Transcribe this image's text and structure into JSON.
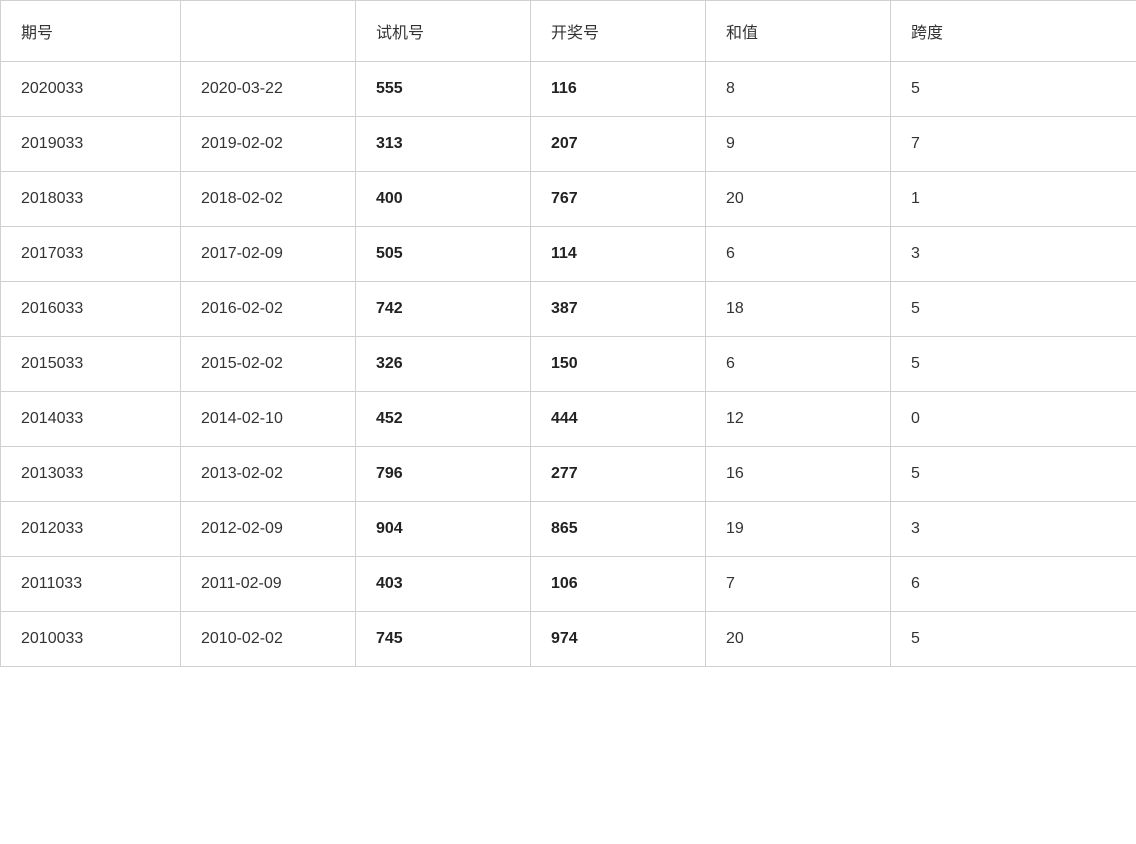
{
  "table": {
    "headers": [
      {
        "key": "qihao",
        "label": "期号"
      },
      {
        "key": "date",
        "label": ""
      },
      {
        "key": "shiji",
        "label": "试机号"
      },
      {
        "key": "kaijang",
        "label": "开奖号"
      },
      {
        "key": "hezhi",
        "label": "和值"
      },
      {
        "key": "kuadu",
        "label": "跨度"
      }
    ],
    "rows": [
      {
        "qihao": "2020033",
        "date": "2020-03-22",
        "shiji": "555",
        "kaijang": "116",
        "hezhi": "8",
        "kuadu": "5"
      },
      {
        "qihao": "2019033",
        "date": "2019-02-02",
        "shiji": "313",
        "kaijang": "207",
        "hezhi": "9",
        "kuadu": "7"
      },
      {
        "qihao": "2018033",
        "date": "2018-02-02",
        "shiji": "400",
        "kaijang": "767",
        "hezhi": "20",
        "kuadu": "1"
      },
      {
        "qihao": "2017033",
        "date": "2017-02-09",
        "shiji": "505",
        "kaijang": "114",
        "hezhi": "6",
        "kuadu": "3"
      },
      {
        "qihao": "2016033",
        "date": "2016-02-02",
        "shiji": "742",
        "kaijang": "387",
        "hezhi": "18",
        "kuadu": "5"
      },
      {
        "qihao": "2015033",
        "date": "2015-02-02",
        "shiji": "326",
        "kaijang": "150",
        "hezhi": "6",
        "kuadu": "5"
      },
      {
        "qihao": "2014033",
        "date": "2014-02-10",
        "shiji": "452",
        "kaijang": "444",
        "hezhi": "12",
        "kuadu": "0"
      },
      {
        "qihao": "2013033",
        "date": "2013-02-02",
        "shiji": "796",
        "kaijang": "277",
        "hezhi": "16",
        "kuadu": "5"
      },
      {
        "qihao": "2012033",
        "date": "2012-02-09",
        "shiji": "904",
        "kaijang": "865",
        "hezhi": "19",
        "kuadu": "3"
      },
      {
        "qihao": "2011033",
        "date": "2011-02-09",
        "shiji": "403",
        "kaijang": "106",
        "hezhi": "7",
        "kuadu": "6"
      },
      {
        "qihao": "2010033",
        "date": "2010-02-02",
        "shiji": "745",
        "kaijang": "974",
        "hezhi": "20",
        "kuadu": "5"
      }
    ]
  }
}
